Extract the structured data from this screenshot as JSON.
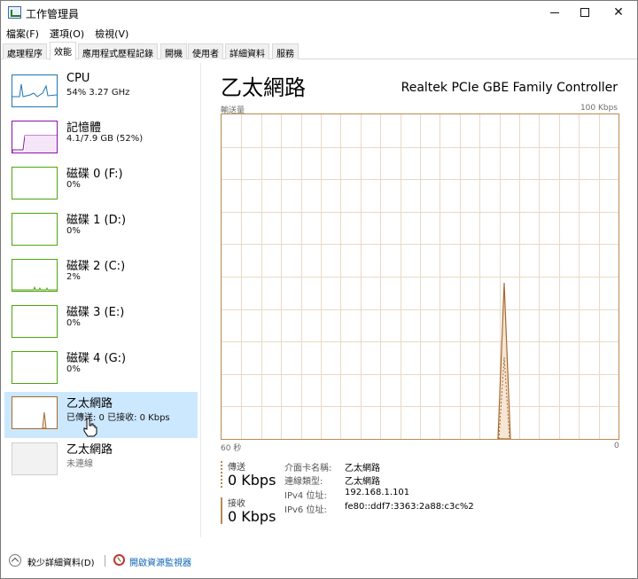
{
  "window": {
    "title": "工作管理員",
    "controls": {
      "minimize": "minimize-icon",
      "maximize": "maximize-icon",
      "close": "close-icon"
    }
  },
  "menu": [
    "檔案(F)",
    "選項(O)",
    "檢視(V)"
  ],
  "tabs": [
    {
      "label": "處理程序",
      "active": false
    },
    {
      "label": "效能",
      "active": true
    },
    {
      "label": "應用程式歷程記錄",
      "active": false
    },
    {
      "label": "開機",
      "active": false
    },
    {
      "label": "使用者",
      "active": false
    },
    {
      "label": "詳細資料",
      "active": false
    },
    {
      "label": "服務",
      "active": false
    }
  ],
  "devices": [
    {
      "name": "CPU",
      "sub": "54%  3.27 GHz",
      "color": "#1f75b5",
      "active": false
    },
    {
      "name": "記憶體",
      "sub": "4.1/7.9 GB (52%)",
      "color": "#8b12ae",
      "active": false
    },
    {
      "name": "磁碟 0 (F:)",
      "sub": "0%",
      "color": "#4da60c",
      "active": false
    },
    {
      "name": "磁碟 1 (D:)",
      "sub": "0%",
      "color": "#4da60c",
      "active": false
    },
    {
      "name": "磁碟 2 (C:)",
      "sub": "2%",
      "color": "#4da60c",
      "active": false
    },
    {
      "name": "磁碟 3 (E:)",
      "sub": "0%",
      "color": "#4da60c",
      "active": false
    },
    {
      "name": "磁碟 4 (G:)",
      "sub": "0%",
      "color": "#4da60c",
      "active": false
    },
    {
      "name": "乙太網路",
      "sub": "已傳送: 0 已接收: 0 Kbps",
      "color": "#a7672b",
      "active": true
    },
    {
      "name": "乙太網路",
      "sub": "未連線",
      "color": "#c8c8c8",
      "active": false
    }
  ],
  "detail": {
    "title": "乙太網路",
    "device": "Realtek PCIe GBE Family Controller",
    "y_label": "輸送量",
    "y_max": "100 Kbps",
    "x_left": "60 秒",
    "x_right": "0",
    "send_label": "傳送",
    "send_value": "0 Kbps",
    "recv_label": "接收",
    "recv_value": "0 Kbps",
    "info": [
      {
        "k": "介面卡名稱:",
        "v": "乙太網路"
      },
      {
        "k": "連線類型:",
        "v": "乙太網路"
      },
      {
        "k": "IPv4 位址:",
        "v": "192.168.1.101"
      },
      {
        "k": "IPv6 位址:",
        "v": "fe80::ddf7:3363:2a88:c3c%2"
      }
    ]
  },
  "bottom": {
    "fewer_details": "較少詳細資料(D)",
    "resource_monitor": "開啟資源監視器"
  },
  "colors": {
    "accent_network": "#a7672b",
    "selected_row": "#cce8ff",
    "link": "#0a63b5"
  }
}
